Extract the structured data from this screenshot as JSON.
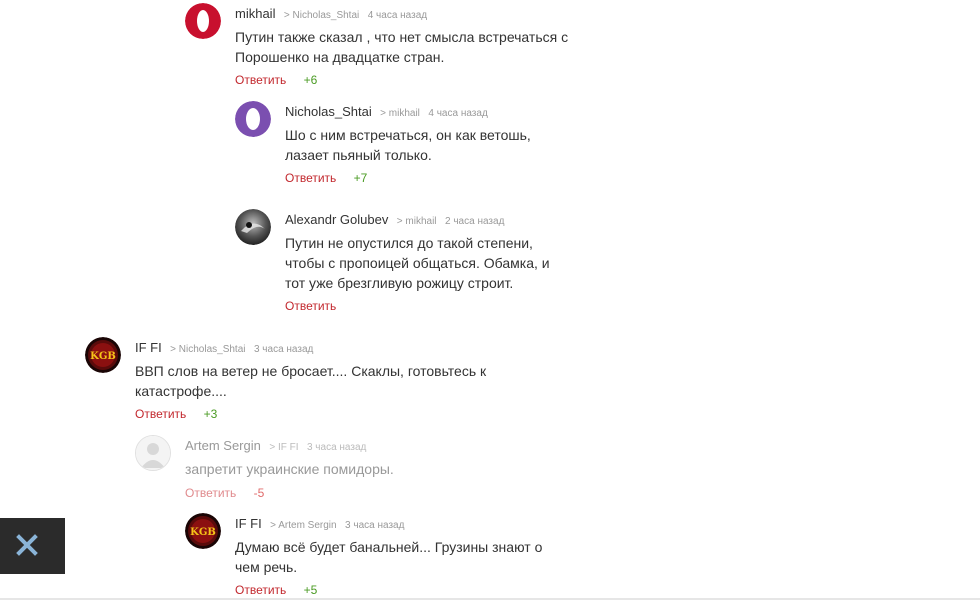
{
  "comments": [
    {
      "author": "mikhail",
      "reply_to": "> Nicholas_Shtai",
      "time": "4 часа назад",
      "text": "Путин также сказал , что нет смысла встречаться с Порошенко на двадцатке стран.",
      "reply_label": "Ответить",
      "score": "+6",
      "avatar": "opera-red-icon"
    },
    {
      "author": "Nicholas_Shtai",
      "reply_to": "> mikhail",
      "time": "4 часа назад",
      "text": "Шо с ним встречаться, он как ветошь, лазает пьяный только.",
      "reply_label": "Ответить",
      "score": "+7",
      "avatar": "opera-purple-icon"
    },
    {
      "author": "Alexandr Golubev",
      "reply_to": "> mikhail",
      "time": "2 часа назад",
      "text": "Путин не опустился до такой степени, чтобы с пропоицей общаться. Обамка, и тот уже брезгливую рожицу строит.",
      "reply_label": "Ответить",
      "score": "",
      "avatar": "photo-avatar"
    },
    {
      "author": "IF FI",
      "reply_to": "> Nicholas_Shtai",
      "time": "3 часа назад",
      "text": "ВВП слов на ветер не бросает.... Скаклы, готовьтесь к катастрофе....",
      "reply_label": "Ответить",
      "score": "+3",
      "avatar": "kgb-logo"
    },
    {
      "author": "Artem Sergin",
      "reply_to": "> IF FI",
      "time": "3 часа назад",
      "text": "запретит украинские помидоры.",
      "reply_label": "Ответить",
      "score": "-5",
      "avatar": "default-user-avatar"
    },
    {
      "author": "IF FI",
      "reply_to": "> Artem Sergin",
      "time": "3 часа назад",
      "text": "Думаю всё будет банальней... Грузины знают о чем речь.",
      "reply_label": "Ответить",
      "score": "+5",
      "avatar": "kgb-logo"
    }
  ],
  "kgb_logo_text": "KGB",
  "close_button_icon": "close-icon",
  "colors": {
    "reply_link": "#c2272d",
    "positive_score": "#4a9b23",
    "negative_score": "#e06b6b",
    "close_box": "#2b2b2b"
  }
}
